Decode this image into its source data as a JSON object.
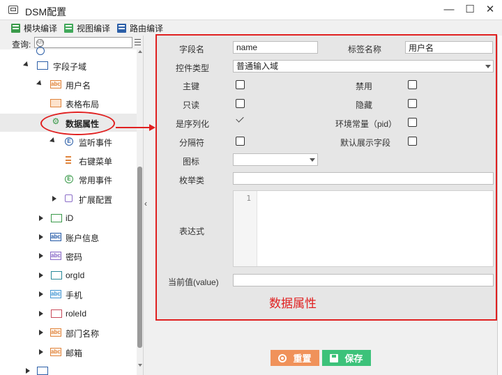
{
  "window": {
    "title": "DSM配置",
    "min_glyph": "—",
    "max_glyph": "☐",
    "close_glyph": "✕"
  },
  "toolbar": {
    "module_compile": "模块编译",
    "view_compile": "视图编译",
    "route_compile": "路由编译"
  },
  "search": {
    "label": "查询:",
    "value": ""
  },
  "tree": {
    "items": [
      {
        "label": "字段子域",
        "icon": "field-domain-icon"
      },
      {
        "label": "用户名",
        "icon": "abc-icon"
      },
      {
        "label": "表格布局",
        "icon": "table-layout-icon"
      },
      {
        "label": "数据属性",
        "icon": "gear-icon"
      },
      {
        "label": "监听事件",
        "icon": "event-icon"
      },
      {
        "label": "右键菜单",
        "icon": "menu-icon"
      },
      {
        "label": "常用事件",
        "icon": "event-icon"
      },
      {
        "label": "扩展配置",
        "icon": "puzzle-icon"
      },
      {
        "label": "iD",
        "icon": "field-icon"
      },
      {
        "label": "账户信息",
        "icon": "abc-icon"
      },
      {
        "label": "密码",
        "icon": "abc-icon"
      },
      {
        "label": "orgId",
        "icon": "field-icon"
      },
      {
        "label": "手机",
        "icon": "abc-icon"
      },
      {
        "label": "roleId",
        "icon": "field-icon"
      },
      {
        "label": "部门名称",
        "icon": "abc-icon"
      },
      {
        "label": "邮箱",
        "icon": "abc-icon"
      }
    ]
  },
  "form": {
    "field_name_label": "字段名",
    "field_name_value": "name",
    "tag_name_label": "标签名称",
    "tag_name_value": "用户名",
    "control_type_label": "控件类型",
    "control_type_value": "普通输入域",
    "primary_key_label": "主键",
    "disabled_label": "禁用",
    "readonly_label": "只读",
    "hidden_label": "隐藏",
    "serialize_label": "是序列化",
    "env_const_label": "环境常量（pid）",
    "separator_label": "分隔符",
    "default_display_label": "默认展示字段",
    "icon_label": "图标",
    "icon_value": "",
    "enum_label": "枚举类",
    "enum_value": "",
    "expression_label": "表达式",
    "expression_line_no": "1",
    "current_value_label": "当前值(value)",
    "current_value_value": "",
    "checks": {
      "primary_key": false,
      "disabled": false,
      "readonly": false,
      "hidden": false,
      "serialize": true,
      "env_const": false,
      "separator": false,
      "default_display": false
    }
  },
  "annotation": {
    "text": "数据属性",
    "color": "#e02020"
  },
  "buttons": {
    "reset": "重置",
    "save": "保存"
  },
  "colors": {
    "reset_button": "#f0925a",
    "save_button": "#3cc27a",
    "highlight": "#e02020"
  }
}
